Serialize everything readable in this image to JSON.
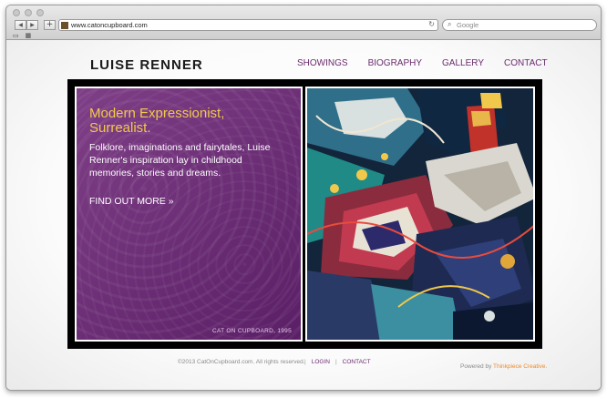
{
  "browser": {
    "url": "www.catoncupboard.com",
    "search_placeholder": "Google",
    "back_glyph": "◀",
    "forward_glyph": "▶",
    "plus_glyph": "+",
    "reload_glyph": "↻",
    "search_glyph": "⌕",
    "reader_glyph": "▭",
    "grid_glyph": "▦"
  },
  "site": {
    "logo": "LUISE RENNER",
    "nav": [
      "SHOWINGS",
      "BIOGRAPHY",
      "GALLERY",
      "CONTACT"
    ]
  },
  "hero": {
    "headline": "Modern Expressionist, Surrealist.",
    "body": "Folklore, imaginations and fairytales, Luise Renner's inspiration lay in childhood memories, stories and dreams.",
    "cta": "FIND OUT MORE »",
    "caption": "CAT ON CUPBOARD, 1995"
  },
  "footer": {
    "copyright": "©2013 CatOnCupboard.com. All rights reserved.",
    "sep1": "|",
    "login": "LOGIN",
    "sep2": "|",
    "contact": "CONTACT",
    "powered": "Powered by ",
    "powered_brand": "Thinkpiece Creative."
  },
  "colors": {
    "accent": "#6b2a6f",
    "headline": "#f2c94c",
    "powered_brand": "#f08a2a"
  }
}
